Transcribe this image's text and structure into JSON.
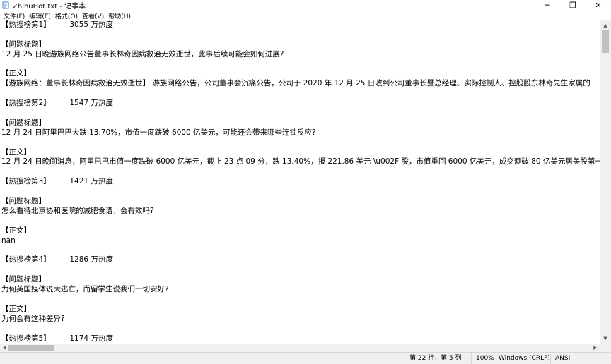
{
  "window": {
    "title": "ZhihuHot.txt - 记事本",
    "minimize_symbol": "─",
    "maximize_symbol": "❐",
    "close_symbol": "✕"
  },
  "menu": [
    "文件(F)",
    "编辑(E)",
    "格式(O)",
    "查看(V)",
    "帮助(H)"
  ],
  "content": {
    "lines": [
      "【热搜榜第1】        3055 万热度",
      "",
      "【问题标题】",
      "12 月 25 日晚游族网络公告董事长林奇因病救治无效逝世，此事后续可能会如何进展?",
      "",
      "【正文】",
      "【游族网络：董事长林奇因病救治无效逝世】 游族网络公告，公司董事会沉痛公告，公司于 2020 年 12 月 25 日收到公司董事长暨总经理、实际控制人、控股股东林奇先生家属的",
      "",
      "【热搜榜第2】        1547 万热度",
      "",
      "【问题标题】",
      "12 月 24 日阿里巴巴大跌 13.70%，市值一度跌破 6000 亿美元，可能还会带来哪些连锁反应?",
      "",
      "【正文】",
      "12 月 24 日晚间消息，阿里巴巴市值一度跌破 6000 亿美元，截止 23 点 09 分，跌 13.40%，报 221.86 美元 \\u002F 股，市值重回 6000 亿美元，成交额破 80 亿美元居美股第一",
      "",
      "【热搜榜第3】        1421 万热度",
      "",
      "【问题标题】",
      "怎么看待北京协和医院的减肥食谱，会有效吗?",
      "",
      "【正文】",
      "nan",
      "",
      "【热搜榜第4】        1286 万热度",
      "",
      "【问题标题】",
      "为何英国媒体说大逃亡，而留学生说我们一切安好?",
      "",
      "【正文】",
      "为何会有这种差异?",
      "",
      "【热搜榜第5】        1174 万热度"
    ]
  },
  "status": {
    "position": "第 22 行，第 5 列",
    "zoom": "100%",
    "line_ending": "Windows (CRLF)",
    "encoding": "ANSI"
  }
}
